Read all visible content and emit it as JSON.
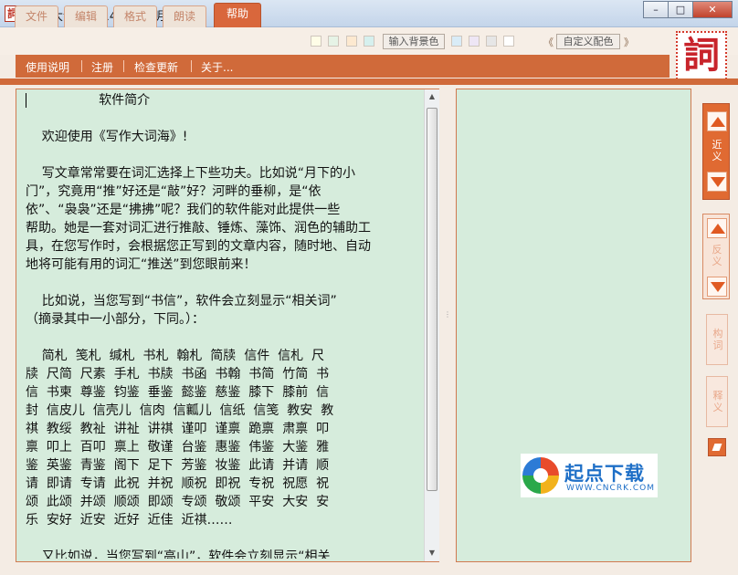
{
  "window": {
    "title": "写作大词海2014 - 清风明月版",
    "icon_glyph": "詞",
    "controls": [
      "–",
      "□",
      "✕"
    ]
  },
  "tabs": [
    {
      "label": "文件",
      "active": false
    },
    {
      "label": "编辑",
      "active": false
    },
    {
      "label": "格式",
      "active": false
    },
    {
      "label": "朗读",
      "active": false
    },
    {
      "label": "帮助",
      "active": true
    }
  ],
  "toolbar": {
    "bg_swatches": [
      "#fffde7",
      "#e6f3e6",
      "#fde9d0",
      "#d6f0ee"
    ],
    "input_bg_label": "输入背景色",
    "fg_swatches": [
      "#d9ecf7",
      "#eee6f5",
      "#e6e6e6",
      "#ffffff"
    ],
    "custom_color_label": "自定义配色",
    "prev_symbol": "《",
    "next_symbol": "》"
  },
  "logo": {
    "glyph": "詞"
  },
  "menu": [
    "使用说明",
    "注册",
    "检查更新",
    "关于..."
  ],
  "document": {
    "lines": [
      "                  软件简介",
      "",
      "    欢迎使用《写作大词海》!",
      "",
      "    写文章常常要在词汇选择上下些功夫。比如说“月下的小",
      "门”，究竟用“推”好还是“敲”好？河畔的垂柳，是“依",
      "依”、“袅袅”还是“拂拂”呢？我们的软件能对此提供一些",
      "帮助。她是一套对词汇进行推敲、锤炼、藻饰、润色的辅助工",
      "具，在您写作时，会根据您正写到的文章内容，随时地、自动",
      "地将可能有用的词汇“推送”到您眼前来！",
      "",
      "    比如说，当您写到“书信”，软件会立刻显示“相关词”",
      "（摘录其中一小部分，下同。）：",
      "",
      "    简札  笺札  缄札  书札  翰札  简牍  信件  信札  尺",
      "牍  尺简  尺素  手札  书牍  书函  书翰  书简  竹简  书",
      "信  书柬  尊鉴  钧鉴  垂鉴  懿鉴  慈鉴  膝下  膝前  信",
      "封  信皮儿  信壳儿  信肉  信瓤儿  信纸  信笺  教安  教",
      "祺  教绥  教祉  讲祉  讲祺  谨叩  谨禀  跪禀  肃禀  叩",
      "禀  叩上  百叩  禀上  敬谨  台鉴  惠鉴  伟鉴  大鉴  雅",
      "鉴  英鉴  青鉴  阁下  足下  芳鉴  妆鉴  此请  并请  顺",
      "请  即请  专请  此祝  并祝  顺祝  即祝  专祝  祝愿  祝",
      "颂  此颂  并颂  顺颂  即颂  专颂  敬颂  平安  大安  安",
      "乐  安好  近安  近好  近佳  近祺……",
      "",
      "    又比如说，当您写到“高山”，软件会立刻显示“相关"
    ]
  },
  "sidebar": {
    "synonym_label": "近义",
    "antonym_label": "反义",
    "wordform_label": "构词",
    "explain_label": "释义"
  },
  "watermark": {
    "main": "起点下载",
    "sub": "WWW.CNCRK.COM"
  },
  "colors": {
    "accent": "#d06a3a",
    "panel_bg": "#d6ecdc",
    "tab_active": "#d9673c"
  }
}
